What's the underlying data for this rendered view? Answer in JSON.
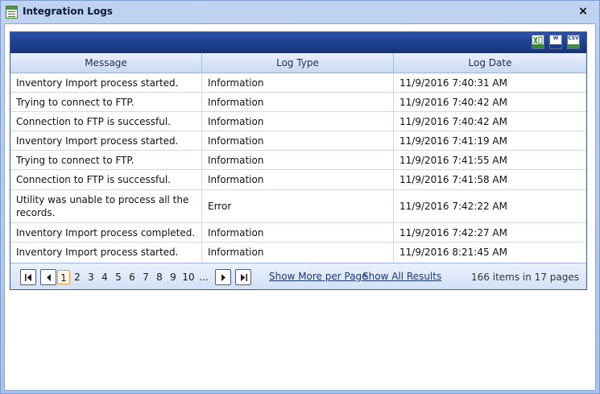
{
  "window": {
    "title": "Integration Logs",
    "close_glyph": "×"
  },
  "grid": {
    "columns": [
      "Message",
      "Log Type",
      "Log Date"
    ],
    "rows": [
      {
        "message": "Inventory Import process started.",
        "log_type": "Information",
        "log_date": "11/9/2016 7:40:31 AM"
      },
      {
        "message": "Trying to connect to FTP.",
        "log_type": "Information",
        "log_date": "11/9/2016 7:40:42 AM"
      },
      {
        "message": "Connection to FTP is successful.",
        "log_type": "Information",
        "log_date": "11/9/2016 7:40:42 AM"
      },
      {
        "message": "Inventory Import process started.",
        "log_type": "Information",
        "log_date": "11/9/2016 7:41:19 AM"
      },
      {
        "message": "Trying to connect to FTP.",
        "log_type": "Information",
        "log_date": "11/9/2016 7:41:55 AM"
      },
      {
        "message": "Connection to FTP is successful.",
        "log_type": "Information",
        "log_date": "11/9/2016 7:41:58 AM"
      },
      {
        "message": "Utility was unable to process all the records.",
        "log_type": "Error",
        "log_date": "11/9/2016 7:42:22 AM"
      },
      {
        "message": "Inventory Import process completed.",
        "log_type": "Information",
        "log_date": "11/9/2016 7:42:27 AM"
      },
      {
        "message": "Inventory Import process started.",
        "log_type": "Information",
        "log_date": "11/9/2016 8:21:45 AM"
      }
    ]
  },
  "toolbar": {
    "export_icons": [
      "excel-export-icon",
      "word-export-icon",
      "csv-export-icon"
    ],
    "word_label": "W",
    "csv_label": "CSV"
  },
  "pager": {
    "pages": [
      "1",
      "2",
      "3",
      "4",
      "5",
      "6",
      "7",
      "8",
      "9",
      "10",
      "..."
    ],
    "current_page": "1",
    "show_more_label": "Show More per Page",
    "show_all_label": "Show All Results",
    "info": "166 items in 17 pages"
  },
  "colors": {
    "toolbar": "#1f3f8e",
    "header": "#c9daf3",
    "active_page_border": "#e09a3c",
    "link": "#1c3a7a"
  }
}
